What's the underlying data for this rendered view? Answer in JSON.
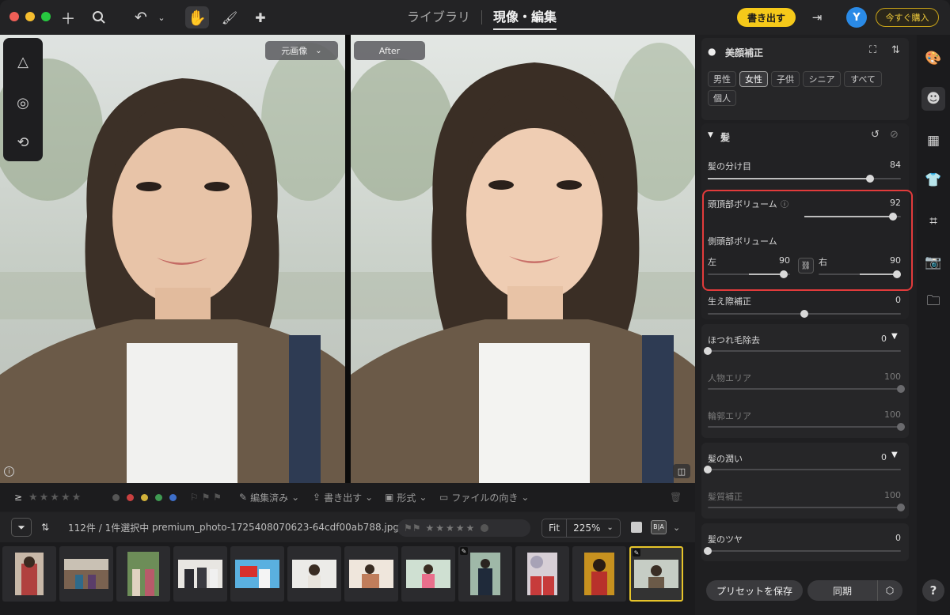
{
  "topbar": {
    "tabs": [
      "ライブラリ",
      "現像・編集"
    ],
    "export_label": "書き出す",
    "avatar_initial": "Y",
    "buy_label": "今すぐ購入"
  },
  "viewer": {
    "before_label": "元画像",
    "after_label": "After"
  },
  "filterbar": {
    "edited": "編集済み",
    "export": "書き出す",
    "format": "形式",
    "orientation": "ファイルの向き",
    "colors": [
      "#555",
      "#c94040",
      "#d1b13a",
      "#3f9a52",
      "#3e6fc9"
    ]
  },
  "statusbar": {
    "count": "112件 / 1件選択中",
    "filename": "premium_photo-1725408070623-64cdf00ab788.jpg",
    "fit_label": "Fit",
    "zoom": "225%"
  },
  "panel": {
    "section_title": "美顔補正",
    "chips": [
      "男性",
      "女性",
      "子供",
      "シニア",
      "すべて",
      "個人"
    ],
    "group_title": "髪",
    "sliders": [
      {
        "label": "髪の分け目",
        "value": "84"
      },
      {
        "label": "頭頂部ボリューム",
        "value": "92"
      },
      {
        "label": "側頭部ボリューム",
        "value": ""
      },
      {
        "label": "生え際補正",
        "value": "0"
      }
    ],
    "side_left": "左",
    "side_left_value": "90",
    "side_right": "右",
    "side_right_value": "90",
    "frizz_label": "ほつれ毛除去",
    "frizz_value": "0",
    "person_area": "人物エリア",
    "person_area_value": "100",
    "contour_area": "輪郭エリア",
    "contour_area_value": "100",
    "moist_label": "髪の潤い",
    "moist_value": "0",
    "quality_label": "髪質補正",
    "quality_value": "100",
    "shine_label": "髪のツヤ",
    "shine_value": "0",
    "preset_label": "プリセットを保存",
    "sync_label": "同期"
  }
}
